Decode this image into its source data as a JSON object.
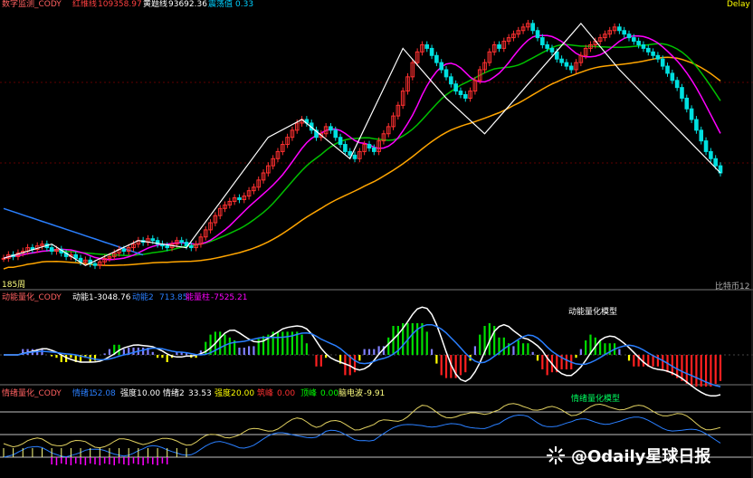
{
  "header": {
    "indicator_name": "数字监测_CODY",
    "red_line_label": "红维线",
    "red_line_value": "109358.97",
    "yellow_line_label": "黄题线",
    "yellow_line_value": "93692.36",
    "wave_label": "震荡值",
    "wave_value": "0.33",
    "delay": "Delay"
  },
  "main": {
    "left_bottom_label": "185周",
    "right_bottom_label": "比特币12"
  },
  "momentum": {
    "indicator_name": "动能量化_CODY",
    "m1_label": "动能1",
    "m1_value": "-3048.76",
    "m2_label": "动能2",
    "m2_value": "713.85",
    "bar_label": "能量柱",
    "bar_value": "-7525.21",
    "model_label": "动能量化模型"
  },
  "emotion": {
    "indicator_name": "情绪量化_CODY",
    "e1_label": "情绪1",
    "e1_value": "52.08",
    "s1_label": "强度1",
    "s1_value": "0.00",
    "e2_label": "情绪2",
    "e2_value": "33.53",
    "s2_label": "强度2",
    "s2_value": "0.00",
    "bottom_label": "筑峰",
    "bottom_value": "0.00",
    "top_label": "顶峰",
    "top_value": "0.00",
    "pulse_label": "脑电波",
    "pulse_value": "-9.91",
    "model_label": "情绪量化模型"
  },
  "watermark": {
    "text": "@Odaily星球日报"
  },
  "colors": {
    "up": "#ff3030",
    "down": "#00e0e0",
    "white_line": "#ffffff",
    "magenta": "#ff00ff",
    "orange": "#ffa500",
    "green": "#00c000",
    "blue": "#2a7fff",
    "yellow": "#f0e080"
  },
  "chart_data": {
    "type": "line",
    "x_count": 150,
    "close": [
      40,
      42,
      41,
      43,
      44,
      46,
      45,
      47,
      48,
      46,
      44,
      45,
      43,
      41,
      42,
      40,
      38,
      39,
      37,
      36,
      38,
      40,
      41,
      43,
      45,
      44,
      46,
      48,
      50,
      49,
      51,
      50,
      48,
      47,
      46,
      48,
      50,
      49,
      47,
      46,
      48,
      52,
      56,
      60,
      64,
      68,
      70,
      72,
      74,
      73,
      75,
      78,
      80,
      84,
      88,
      92,
      96,
      100,
      104,
      108,
      112,
      116,
      118,
      116,
      112,
      108,
      110,
      114,
      112,
      108,
      104,
      100,
      98,
      96,
      100,
      104,
      102,
      100,
      106,
      110,
      114,
      120,
      126,
      134,
      142,
      150,
      156,
      160,
      158,
      154,
      150,
      146,
      142,
      138,
      134,
      132,
      130,
      134,
      140,
      146,
      150,
      156,
      160,
      158,
      162,
      164,
      166,
      168,
      170,
      172,
      168,
      164,
      160,
      158,
      156,
      152,
      150,
      148,
      146,
      150,
      154,
      158,
      160,
      162,
      164,
      166,
      168,
      170,
      168,
      166,
      164,
      162,
      160,
      158,
      156,
      154,
      152,
      148,
      144,
      140,
      136,
      130,
      124,
      118,
      112,
      106,
      100,
      96,
      92,
      88
    ],
    "series": [
      {
        "name": "红维线",
        "value": 109358.97
      },
      {
        "name": "黄题线",
        "value": 93692.36
      }
    ]
  }
}
